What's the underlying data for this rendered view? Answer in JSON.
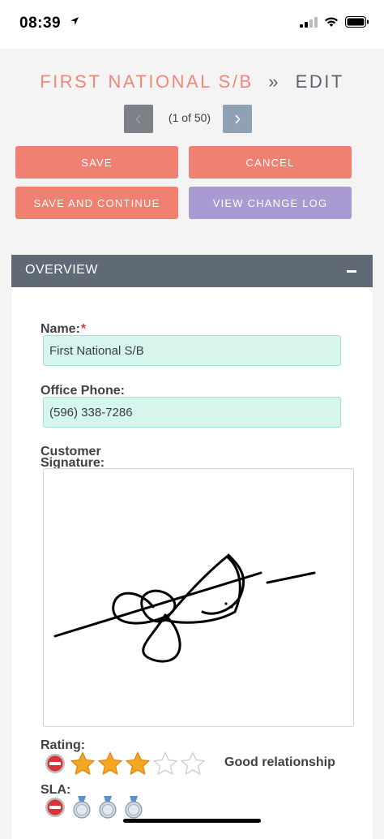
{
  "status_bar": {
    "time": "08:39"
  },
  "header": {
    "module": "FIRST NATIONAL S/B",
    "separator": "»",
    "action": "EDIT"
  },
  "pager": {
    "count": "(1 of 50)"
  },
  "buttons": {
    "save": "SAVE",
    "cancel": "CANCEL",
    "save_continue": "SAVE AND CONTINUE",
    "change_log": "VIEW CHANGE LOG"
  },
  "panel": {
    "title": "OVERVIEW"
  },
  "fields": {
    "name": {
      "label": "Name:",
      "required_mark": "*",
      "value": "First National S/B"
    },
    "office_phone": {
      "label": "Office Phone:",
      "value": "(596) 338-7286"
    },
    "signature": {
      "label_line1": "Customer",
      "label_line2": "Signature:"
    },
    "rating": {
      "label": "Rating:",
      "value": 3,
      "max": 5,
      "text": "Good relationship"
    },
    "sla": {
      "label": "SLA:",
      "value": 3,
      "max": 3
    }
  },
  "colors": {
    "accent": "#ef8072",
    "secondary_button": "#a99ad1",
    "panel_header": "#606a76",
    "input_bg": "#d6f6ed",
    "star": "#f5a623"
  }
}
